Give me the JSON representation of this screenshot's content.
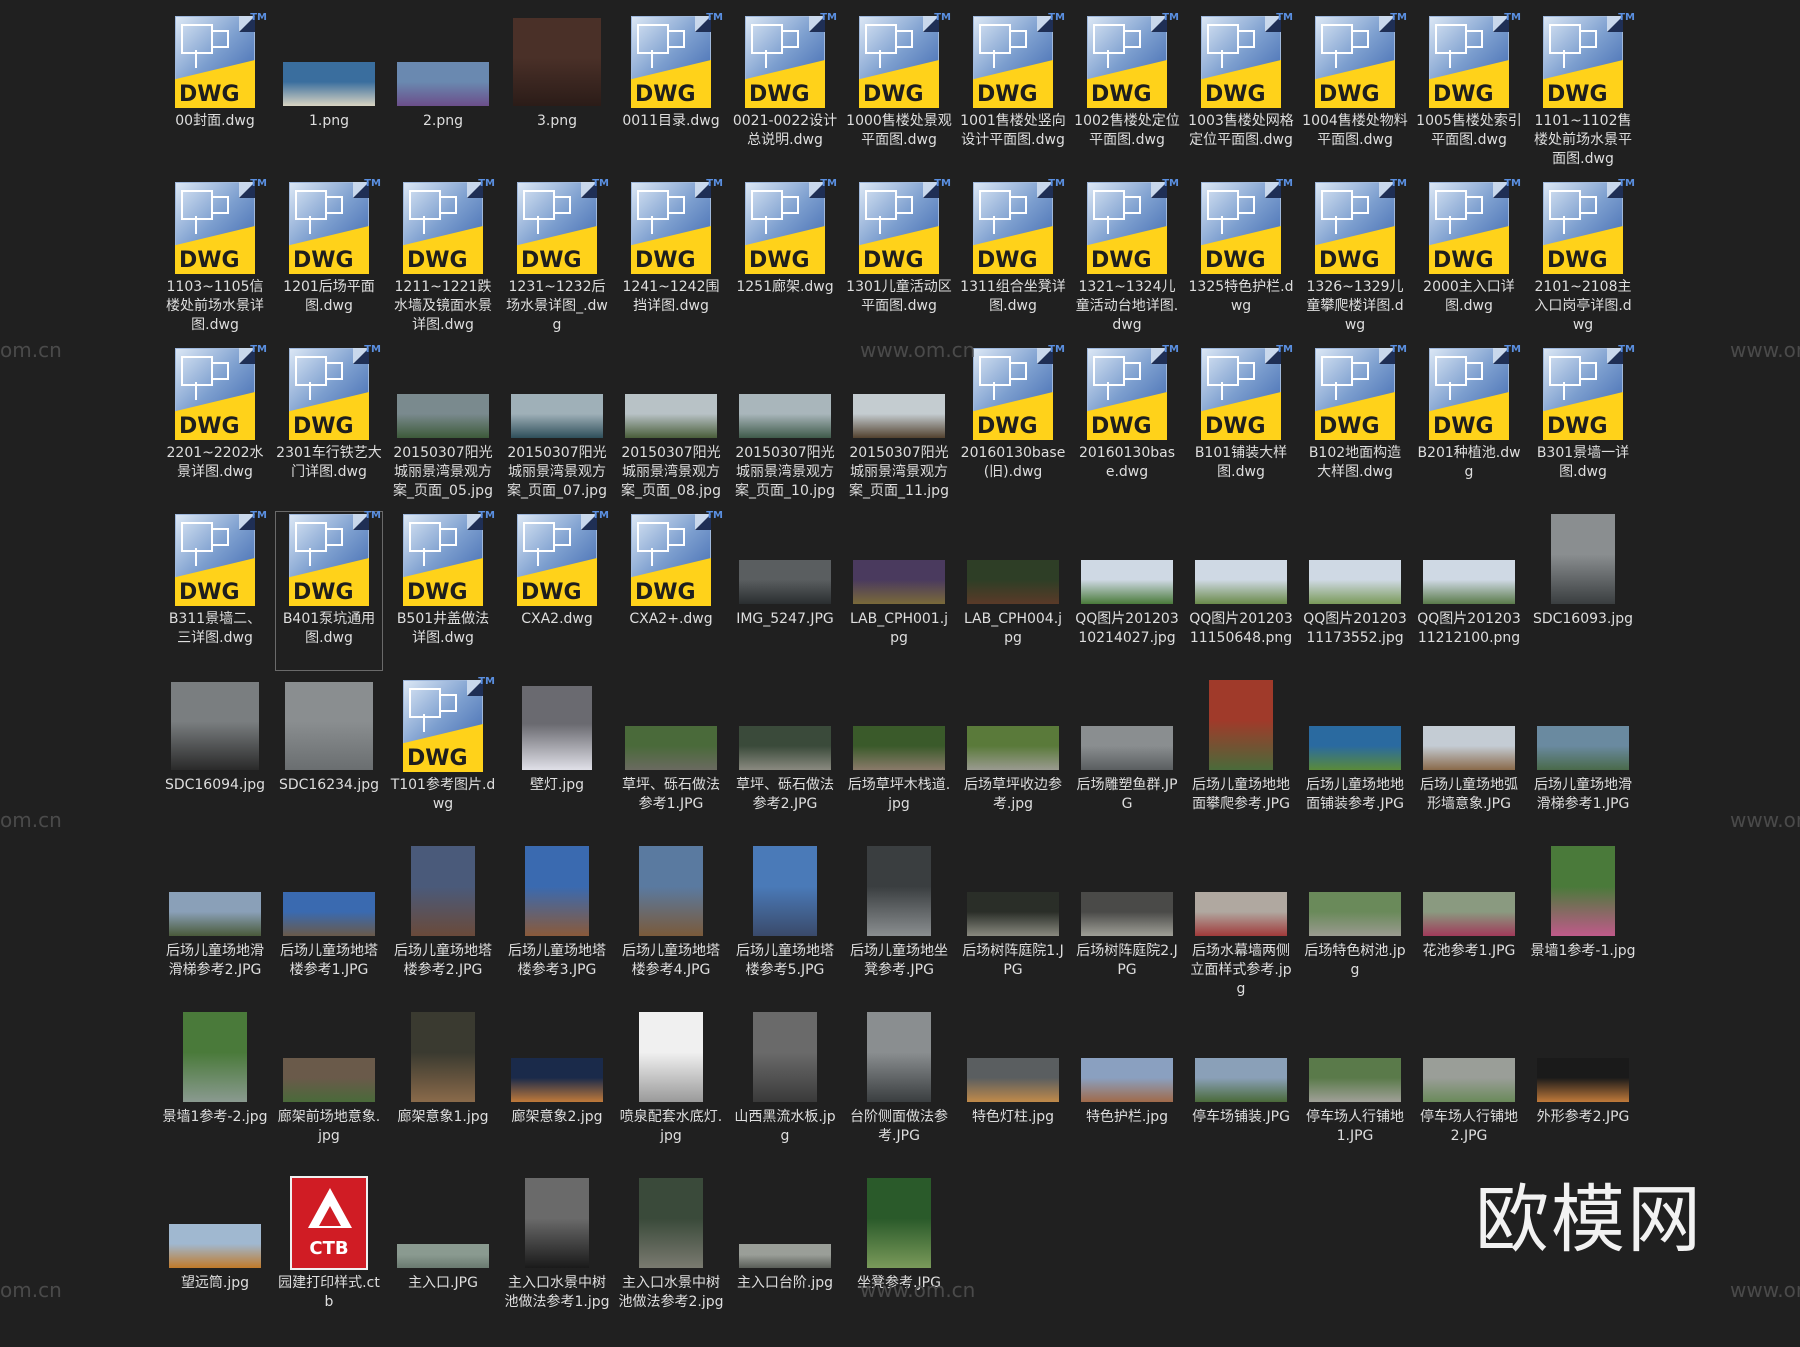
{
  "watermarks": {
    "brand": "欧模网",
    "site": "www.om.cn",
    "site_short": "om.cn"
  },
  "files": [
    {
      "name": "00封面.dwg",
      "kind": "dwg"
    },
    {
      "name": "1.png",
      "kind": "img",
      "th": "wide",
      "c1": "#3a6e9e",
      "c2": "#d9d4c2"
    },
    {
      "name": "2.png",
      "kind": "img",
      "th": "wide",
      "c1": "#6a89b0",
      "c2": "#6b4e8a"
    },
    {
      "name": "3.png",
      "kind": "img",
      "th": "square",
      "c1": "#4a3028",
      "c2": "#2b1c18"
    },
    {
      "name": "0011目录.dwg",
      "kind": "dwg"
    },
    {
      "name": "0021-0022设计总说明.dwg",
      "kind": "dwg"
    },
    {
      "name": "1000售楼处景观平面图.dwg",
      "kind": "dwg"
    },
    {
      "name": "1001售楼处竖向设计平面图.dwg",
      "kind": "dwg"
    },
    {
      "name": "1002售楼处定位平面图.dwg",
      "kind": "dwg"
    },
    {
      "name": "1003售楼处网格定位平面图.dwg",
      "kind": "dwg"
    },
    {
      "name": "1004售楼处物料平面图.dwg",
      "kind": "dwg"
    },
    {
      "name": "1005售楼处索引平面图.dwg",
      "kind": "dwg"
    },
    {
      "name": "1101~1102售楼处前场水景平面图.dwg",
      "kind": "dwg"
    },
    {
      "name": "1103~1105信楼处前场水景详图.dwg",
      "kind": "dwg"
    },
    {
      "name": "1201后场平面图.dwg",
      "kind": "dwg"
    },
    {
      "name": "1211~1221跌水墙及镜面水景详图.dwg",
      "kind": "dwg"
    },
    {
      "name": "1231~1232后场水景详图_.dwg",
      "kind": "dwg"
    },
    {
      "name": "1241~1242围挡详图.dwg",
      "kind": "dwg"
    },
    {
      "name": "1251廊架.dwg",
      "kind": "dwg"
    },
    {
      "name": "1301儿童活动区平面图.dwg",
      "kind": "dwg"
    },
    {
      "name": "1311组合坐凳详图.dwg",
      "kind": "dwg"
    },
    {
      "name": "1321~1324儿童活动台地详图.dwg",
      "kind": "dwg"
    },
    {
      "name": "1325特色护栏.dwg",
      "kind": "dwg"
    },
    {
      "name": "1326~1329儿童攀爬楼详图.dwg",
      "kind": "dwg"
    },
    {
      "name": "2000主入口详图.dwg",
      "kind": "dwg"
    },
    {
      "name": "2101~2108主入口岗亭详图.dwg",
      "kind": "dwg"
    },
    {
      "name": "2201~2202水景详图.dwg",
      "kind": "dwg"
    },
    {
      "name": "2301车行铁艺大门详图.dwg",
      "kind": "dwg"
    },
    {
      "name": "20150307阳光城丽景湾景观方案_页面_05.jpg",
      "kind": "img",
      "th": "wide",
      "c1": "#7a8a8e",
      "c2": "#3d5a3a"
    },
    {
      "name": "20150307阳光城丽景湾景观方案_页面_07.jpg",
      "kind": "img",
      "th": "wide",
      "c1": "#9fb0b8",
      "c2": "#2f4f5a"
    },
    {
      "name": "20150307阳光城丽景湾景观方案_页面_08.jpg",
      "kind": "img",
      "th": "wide",
      "c1": "#b8c2c6",
      "c2": "#4a5e3a"
    },
    {
      "name": "20150307阳光城丽景湾景观方案_页面_10.jpg",
      "kind": "img",
      "th": "wide",
      "c1": "#a9b6bb",
      "c2": "#3f5a4a"
    },
    {
      "name": "20150307阳光城丽景湾景观方案_页面_11.jpg",
      "kind": "img",
      "th": "wide",
      "c1": "#c4ccd0",
      "c2": "#53422f"
    },
    {
      "name": "20160130base(旧).dwg",
      "kind": "dwg"
    },
    {
      "name": "20160130base.dwg",
      "kind": "dwg"
    },
    {
      "name": "B101铺装大样图.dwg",
      "kind": "dwg"
    },
    {
      "name": "B102地面构造大样图.dwg",
      "kind": "dwg"
    },
    {
      "name": "B201种植池.dwg",
      "kind": "dwg"
    },
    {
      "name": "B301景墙一详图.dwg",
      "kind": "dwg"
    },
    {
      "name": "B311景墙二、三详图.dwg",
      "kind": "dwg"
    },
    {
      "name": "B401泵坑通用图.dwg",
      "kind": "dwg",
      "selected": true
    },
    {
      "name": "B501井盖做法详图.dwg",
      "kind": "dwg"
    },
    {
      "name": "CXA2.dwg",
      "kind": "dwg"
    },
    {
      "name": "CXA2+.dwg",
      "kind": "dwg"
    },
    {
      "name": "IMG_5247.JPG",
      "kind": "img",
      "th": "wide",
      "c1": "#5a5e60",
      "c2": "#2a2e30"
    },
    {
      "name": "LAB_CPH001.jpg",
      "kind": "img",
      "th": "wide",
      "c1": "#4a3a5e",
      "c2": "#7a6a3a"
    },
    {
      "name": "LAB_CPH004.jpg",
      "kind": "img",
      "th": "wide",
      "c1": "#2e3e26",
      "c2": "#5a3a28"
    },
    {
      "name": "QQ图片20120310214027.jpg",
      "kind": "img",
      "th": "wide",
      "c1": "#cfd9e4",
      "c2": "#4a7a3a"
    },
    {
      "name": "QQ图片20120311150648.png",
      "kind": "img",
      "th": "wide",
      "c1": "#cfd9e4",
      "c2": "#6a8a4a"
    },
    {
      "name": "QQ图片20120311173552.jpg",
      "kind": "img",
      "th": "wide",
      "c1": "#cfd9e4",
      "c2": "#7a9a5a"
    },
    {
      "name": "QQ图片20120311212100.png",
      "kind": "img",
      "th": "wide",
      "c1": "#cfd9e4",
      "c2": "#5a7a4a"
    },
    {
      "name": "SDC16093.jpg",
      "kind": "img",
      "th": "tall",
      "c1": "#8a8e90",
      "c2": "#3a3e40"
    },
    {
      "name": "SDC16094.jpg",
      "kind": "img",
      "th": "square",
      "c1": "#7a7e80",
      "c2": "#2a2a2a"
    },
    {
      "name": "SDC16234.jpg",
      "kind": "img",
      "th": "square",
      "c1": "#8a8e90",
      "c2": "#6a6e70"
    },
    {
      "name": "T101参考图片.dwg",
      "kind": "dwg"
    },
    {
      "name": "壁灯.jpg",
      "kind": "img",
      "th": "tallsq",
      "c1": "#6a6a70",
      "c2": "#e0e0e8"
    },
    {
      "name": "草坪、砾石做法参考1.JPG",
      "kind": "img",
      "th": "wide",
      "c1": "#4a6a3a",
      "c2": "#6a6a60"
    },
    {
      "name": "草坪、砾石做法参考2.JPG",
      "kind": "img",
      "th": "wide",
      "c1": "#3a4a3a",
      "c2": "#8a8a80"
    },
    {
      "name": "后场草坪木栈道.jpg",
      "kind": "img",
      "th": "wide",
      "c1": "#3a5a2a",
      "c2": "#8a7a6a"
    },
    {
      "name": "后场草坪收边参考.jpg",
      "kind": "img",
      "th": "wide",
      "c1": "#5a7a3a",
      "c2": "#9a9a90"
    },
    {
      "name": "后场雕塑鱼群.JPG",
      "kind": "img",
      "th": "wide",
      "c1": "#8a8e90",
      "c2": "#5a5e60"
    },
    {
      "name": "后场儿童场地地面攀爬参考.JPG",
      "kind": "img",
      "th": "tall",
      "c1": "#a03a2a",
      "c2": "#4a6a3a"
    },
    {
      "name": "后场儿童场地地面铺装参考.JPG",
      "kind": "img",
      "th": "wide",
      "c1": "#2a6aa0",
      "c2": "#5a8a3a"
    },
    {
      "name": "后场儿童场地弧形墙意象.JPG",
      "kind": "img",
      "th": "wide",
      "c1": "#c4ccd4",
      "c2": "#8a6a4a"
    },
    {
      "name": "后场儿童场地滑滑梯参考1.JPG",
      "kind": "img",
      "th": "wide",
      "c1": "#6a8aa0",
      "c2": "#4a6a4a"
    },
    {
      "name": "后场儿童场地滑滑梯参考2.JPG",
      "kind": "img",
      "th": "wide",
      "c1": "#8aa0b8",
      "c2": "#4a5a3a"
    },
    {
      "name": "后场儿童场地塔楼参考1.JPG",
      "kind": "img",
      "th": "wide",
      "c1": "#3a6ab0",
      "c2": "#6a5a4a"
    },
    {
      "name": "后场儿童场地塔楼参考2.JPG",
      "kind": "img",
      "th": "tall",
      "c1": "#4a5a7a",
      "c2": "#6a4a3a"
    },
    {
      "name": "后场儿童场地塔楼参考3.JPG",
      "kind": "img",
      "th": "tall",
      "c1": "#3a6ab0",
      "c2": "#8a5a3a"
    },
    {
      "name": "后场儿童场地塔楼参考4.JPG",
      "kind": "img",
      "th": "tall",
      "c1": "#5a7aa0",
      "c2": "#7a5a3a"
    },
    {
      "name": "后场儿童场地塔楼参考5.JPG",
      "kind": "img",
      "th": "tall",
      "c1": "#4a7ab8",
      "c2": "#3a4a6a"
    },
    {
      "name": "后场儿童场地坐凳参考.JPG",
      "kind": "img",
      "th": "tall",
      "c1": "#3a3e40",
      "c2": "#8a8e90"
    },
    {
      "name": "后场树阵庭院1.JPG",
      "kind": "img",
      "th": "wide",
      "c1": "#2a2e28",
      "c2": "#8a8a80"
    },
    {
      "name": "后场树阵庭院2.JPG",
      "kind": "img",
      "th": "wide",
      "c1": "#4a4a48",
      "c2": "#a0a098"
    },
    {
      "name": "后场水幕墙两侧立面样式参考.jpg",
      "kind": "img",
      "th": "wide",
      "c1": "#b0a8a0",
      "c2": "#a03a3a"
    },
    {
      "name": "后场特色树池.jpg",
      "kind": "img",
      "th": "wide",
      "c1": "#6a8a5a",
      "c2": "#9a9a90"
    },
    {
      "name": "花池参考1.JPG",
      "kind": "img",
      "th": "wide",
      "c1": "#8a9a80",
      "c2": "#a03a5a"
    },
    {
      "name": "景墙1参考-1.jpg",
      "kind": "img",
      "th": "tall",
      "c1": "#4a7a3a",
      "c2": "#c05a8a"
    },
    {
      "name": "景墙1参考-2.jpg",
      "kind": "img",
      "th": "tall",
      "c1": "#4a7a3a",
      "c2": "#8a9a90"
    },
    {
      "name": "廊架前场地意象.jpg",
      "kind": "img",
      "th": "wide",
      "c1": "#6a5a4a",
      "c2": "#4a6a3a"
    },
    {
      "name": "廊架意象1.jpg",
      "kind": "img",
      "th": "tall",
      "c1": "#3a3a30",
      "c2": "#8a6a4a"
    },
    {
      "name": "廊架意象2.jpg",
      "kind": "img",
      "th": "wide",
      "c1": "#1a2a4a",
      "c2": "#c07a3a"
    },
    {
      "name": "喷泉配套水底灯.jpg",
      "kind": "img",
      "th": "tall",
      "c1": "#f0f0f0",
      "c2": "#9a9a9a"
    },
    {
      "name": "山西黑流水板.jpg",
      "kind": "img",
      "th": "tall",
      "c1": "#6a6a6a",
      "c2": "#3a3a3a"
    },
    {
      "name": "台阶侧面做法参考.JPG",
      "kind": "img",
      "th": "tall",
      "c1": "#8a8e90",
      "c2": "#3a3e40"
    },
    {
      "name": "特色灯柱.jpg",
      "kind": "img",
      "th": "wide",
      "c1": "#5a5e60",
      "c2": "#c08a4a"
    },
    {
      "name": "特色护栏.jpg",
      "kind": "img",
      "th": "wide",
      "c1": "#8aa0c0",
      "c2": "#a06a4a"
    },
    {
      "name": "停车场铺装.JPG",
      "kind": "img",
      "th": "wide",
      "c1": "#8aa0b8",
      "c2": "#4a6a3a"
    },
    {
      "name": "停车场人行铺地1.JPG",
      "kind": "img",
      "th": "wide",
      "c1": "#5a7a4a",
      "c2": "#a0a098"
    },
    {
      "name": "停车场人行铺地2.JPG",
      "kind": "img",
      "th": "wide",
      "c1": "#9a9e98",
      "c2": "#6a8a5a"
    },
    {
      "name": "外形参考2.JPG",
      "kind": "img",
      "th": "wide",
      "c1": "#1a1a1a",
      "c2": "#c07a3a"
    },
    {
      "name": "望远筒.jpg",
      "kind": "img",
      "th": "wide",
      "c1": "#a0b8d0",
      "c2": "#c07a2a"
    },
    {
      "name": "园建打印样式.ctb",
      "kind": "ctb"
    },
    {
      "name": "主入口.JPG",
      "kind": "img",
      "th": "thin",
      "c1": "#8a9a90",
      "c2": "#6a7a70"
    },
    {
      "name": "主入口水景中树池做法参考1.jpg",
      "kind": "img",
      "th": "tall",
      "c1": "#6a6a6a",
      "c2": "#1a1a1a"
    },
    {
      "name": "主入口水景中树池做法参考2.jpg",
      "kind": "img",
      "th": "tall",
      "c1": "#3a4a3a",
      "c2": "#7a7a70"
    },
    {
      "name": "主入口台阶.jpg",
      "kind": "img",
      "th": "thin",
      "c1": "#9a9e98",
      "c2": "#5a5e58"
    },
    {
      "name": "坐凳参考.JPG",
      "kind": "img",
      "th": "tall",
      "c1": "#2a5a2a",
      "c2": "#7a9a5a"
    }
  ]
}
